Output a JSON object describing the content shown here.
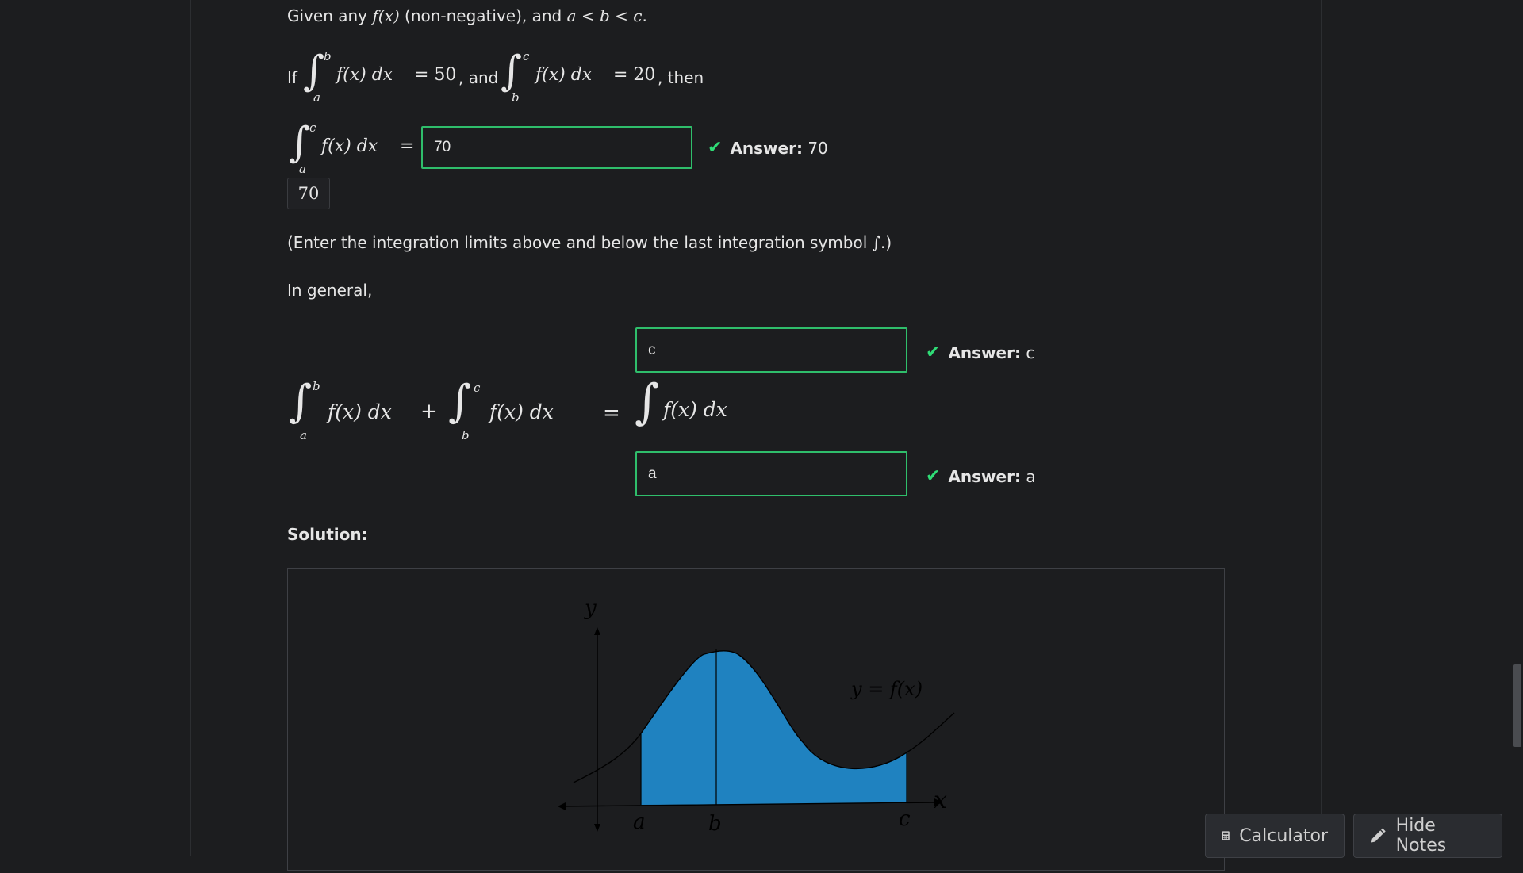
{
  "intro": {
    "given_prefix": "Given any",
    "fx": "f(x)",
    "nonneg": "(non-negative), and",
    "order": "a < b < c",
    "period": "."
  },
  "premise": {
    "if_word": "If",
    "int1": {
      "upper": "b",
      "lower": "a",
      "integrand": "f(x) dx",
      "equals": "= 50"
    },
    "and_word": ", and",
    "int2": {
      "upper": "c",
      "lower": "b",
      "integrand": "f(x) dx",
      "equals": "= 20"
    },
    "then_word": ", then"
  },
  "question1": {
    "upper": "c",
    "lower": "a",
    "integrand": "f(x) dx",
    "equals": "=",
    "input_value": "70",
    "preview": "70",
    "answer_label": "Answer:",
    "answer_value": "70"
  },
  "hint": "(Enter the integration limits above and below the last integration symbol",
  "hint_symbol": "∫",
  "hint_end": ".)",
  "in_general": "In general,",
  "general_eq": {
    "int1": {
      "upper": "b",
      "lower": "a",
      "integrand": "f(x) dx"
    },
    "plus": "+",
    "int2": {
      "upper": "c",
      "lower": "b",
      "integrand": "f(x) dx"
    },
    "equals": "=",
    "rhs_integrand": "f(x) dx",
    "upper_input": "c",
    "lower_input": "a",
    "answer_label": "Answer:",
    "upper_answer": "c",
    "lower_answer": "a"
  },
  "solution_label": "Solution:",
  "figure": {
    "y_axis": "y",
    "x_axis": "x",
    "curve_label": "y = f(x)",
    "tick_a": "a",
    "tick_b": "b",
    "tick_c": "c"
  },
  "buttons": {
    "calculator": "Calculator",
    "hide_notes": "Hide Notes"
  },
  "colors": {
    "success": "#2fdc76",
    "fill": "#1f82c0"
  },
  "icons": {
    "check": "check-icon",
    "calculator": "calculator-icon",
    "pencil": "pencil-icon"
  }
}
